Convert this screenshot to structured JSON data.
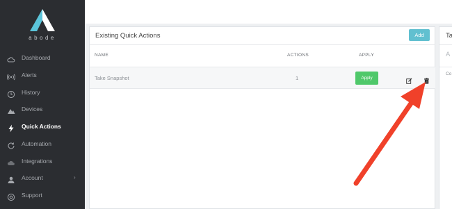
{
  "brand": {
    "logo_text": "abode"
  },
  "sidebar": {
    "items": [
      {
        "label": "Dashboard",
        "icon": "cloud-icon"
      },
      {
        "label": "Alerts",
        "icon": "broadcast-icon"
      },
      {
        "label": "History",
        "icon": "clock-icon"
      },
      {
        "label": "Devices",
        "icon": "mountains-icon"
      },
      {
        "label": "Quick Actions",
        "icon": "lightning-icon",
        "active": true
      },
      {
        "label": "Automation",
        "icon": "refresh-icon"
      },
      {
        "label": "Integrations",
        "icon": "cloud-outline-icon"
      },
      {
        "label": "Account",
        "icon": "user-icon",
        "chevron": "›"
      },
      {
        "label": "Support",
        "icon": "help-icon"
      }
    ]
  },
  "quick_actions": {
    "title": "Existing Quick Actions",
    "add_label": "Add",
    "columns": {
      "name": "NAME",
      "actions": "ACTIONS",
      "apply": "APPLY"
    },
    "rows": [
      {
        "name": "Take Snapshot",
        "actions": "1",
        "apply_label": "Apply"
      }
    ]
  },
  "right_panel": {
    "title": "Ta",
    "subtitle": "A",
    "small": "Co"
  },
  "colors": {
    "sidebar_bg": "#2b2d31",
    "add_button": "#61c0d0",
    "apply_button": "#4fc86a",
    "arrow": "#f0412a"
  }
}
